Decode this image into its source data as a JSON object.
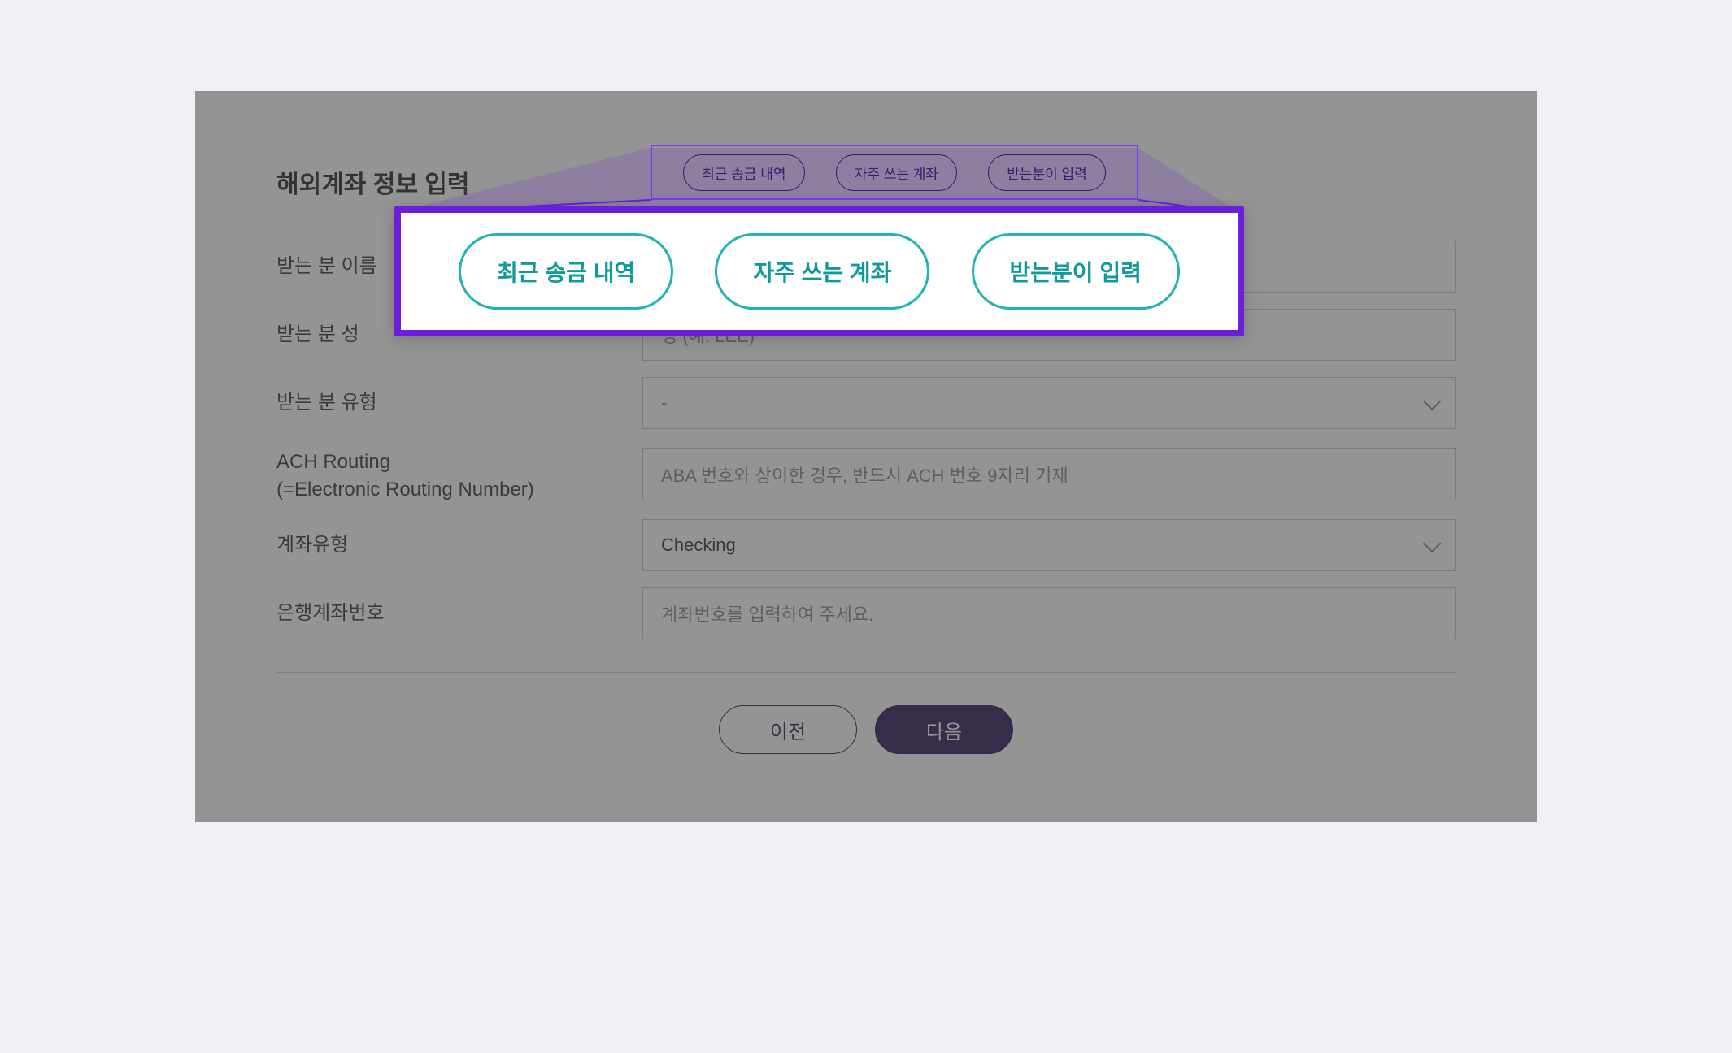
{
  "section": {
    "title": "해외계좌 정보 입력"
  },
  "pills": {
    "recent": "최근 송금 내역",
    "frequent": "자주 쓰는 계좌",
    "recipient": "받는분이 입력"
  },
  "form": {
    "recipient_name_label": "받는 분 이름",
    "recipient_surname_label": "받는 분 성",
    "recipient_surname_placeholder": "성 (예: LEE)",
    "recipient_type_label": "받는 분 유형",
    "recipient_type_value": "-",
    "ach_label": "ACH Routing\n(=Electronic Routing Number)",
    "ach_placeholder": "ABA 번호와 상이한 경우, 반드시 ACH 번호 9자리 기재",
    "account_type_label": "계좌유형",
    "account_type_value": "Checking",
    "account_number_label": "은행계좌번호",
    "account_number_placeholder": "계좌번호를 입력하여 주세요."
  },
  "nav": {
    "prev": "이전",
    "next": "다음"
  }
}
